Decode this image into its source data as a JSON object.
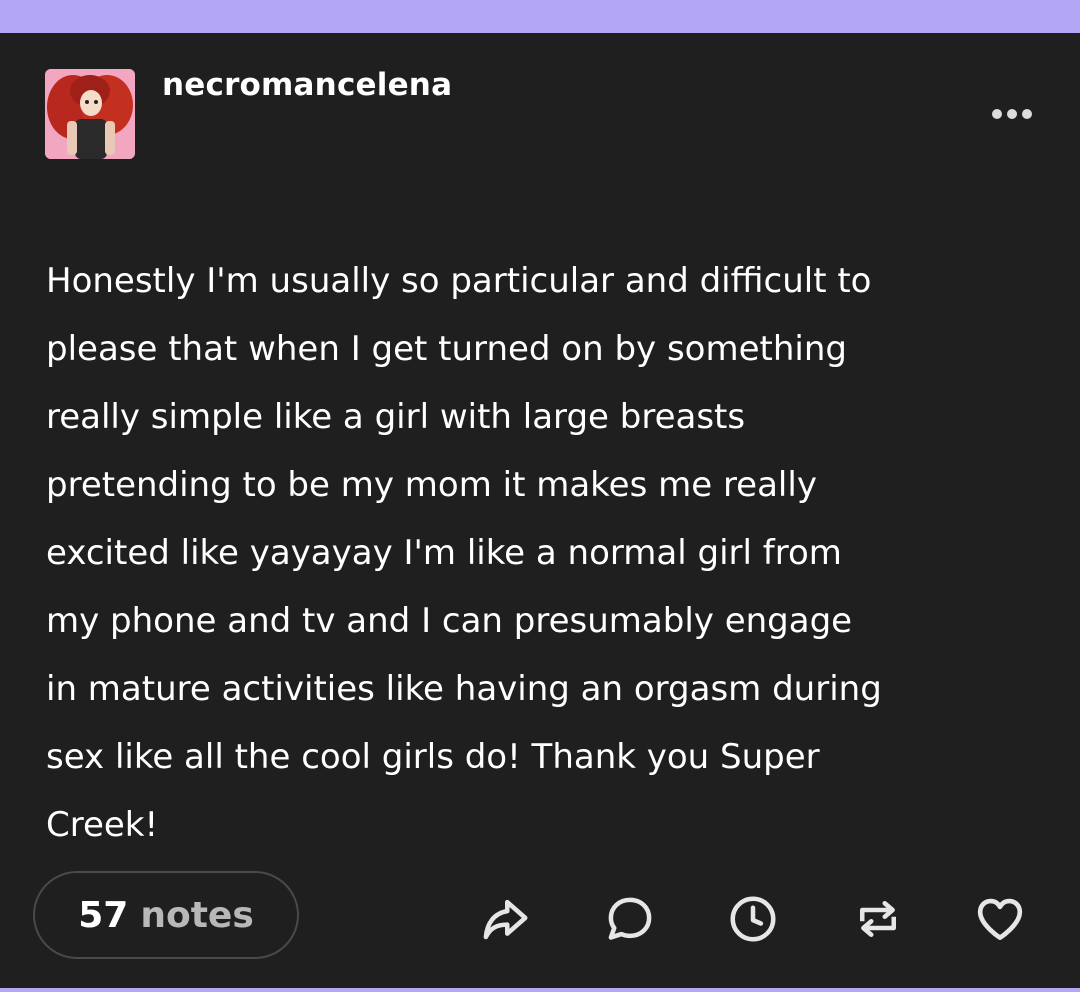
{
  "post": {
    "username": "necromancelena",
    "body_lines": [
      "Honestly I'm usually so particular and difficult to",
      "please that when I get turned on by something",
      "really simple like a girl with large breasts",
      "pretending to be my mom it makes me really",
      "excited like yayayay I'm like a normal girl from",
      "my phone and tv and I can presumably engage",
      "in mature activities like having an orgasm during",
      "sex like all the cool girls do! Thank you Super",
      "Creek!"
    ],
    "notes_count": "57",
    "notes_label": "notes"
  },
  "icons": {
    "more": "more-horizontal-icon",
    "share": "share-icon",
    "reply": "reply-icon",
    "queue": "clock-icon",
    "reblog": "reblog-icon",
    "like": "heart-icon"
  },
  "colors": {
    "top_bar": "#b3a6f5",
    "post_background": "#1f1f1f",
    "text": "#ffffff",
    "notes_label": "#b8b8b8",
    "icon": "#e6e6e6"
  }
}
